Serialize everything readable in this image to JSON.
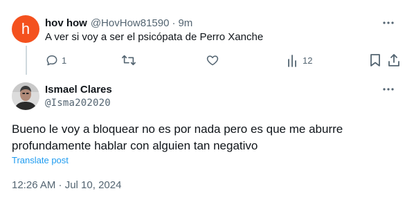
{
  "reply_tweet": {
    "avatar_letter": "h",
    "display_name": "hov how",
    "handle": "@HovHow81590",
    "separator": "·",
    "time_ago": "9m",
    "text": "A ver si voy a ser el psicópata de Perro Xanche",
    "actions": {
      "reply_count": "1",
      "retweet_count": "",
      "like_count": "",
      "views_count": "12"
    },
    "avatar_color": "#f4511e"
  },
  "main_tweet": {
    "display_name": "Ismael Clares",
    "handle": "@Isma202020",
    "text": "Bueno le voy a bloquear no es por nada pero es que me aburre profundamente hablar con alguien tan negativo",
    "translate_label": "Translate post",
    "timestamp": "12:26 AM · Jul 10, 2024"
  },
  "icons": {
    "reply": "comment-icon",
    "retweet": "retweet-icon",
    "like": "heart-icon",
    "views": "bar-chart-icon",
    "bookmark": "bookmark-icon",
    "share": "share-icon",
    "more": "more-dots-icon"
  },
  "colors": {
    "text_primary": "#0f1419",
    "text_muted": "#536471",
    "link": "#1d9bf0",
    "thread_line": "#cfd9de"
  }
}
